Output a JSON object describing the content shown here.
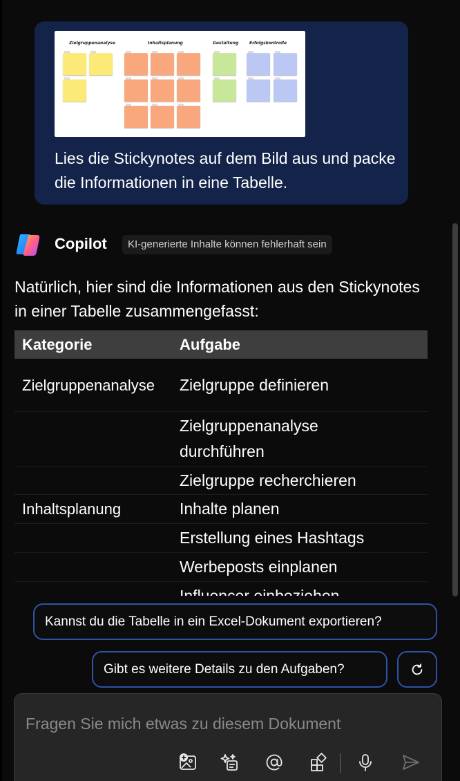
{
  "user_message": {
    "image": {
      "columns": [
        "Zielgruppenanalyse",
        "Inhaltsplanung",
        "Gestaltung",
        "Erfolgskontrolle"
      ]
    },
    "text": "Lies die Stickynotes auf dem Bild aus und packe die Informationen in eine Tabelle."
  },
  "assistant": {
    "name": "Copilot",
    "badge": "KI-generierte Inhalte können fehlerhaft sein",
    "intro": "Natürlich, hier sind die Informationen aus den Stickynotes in einer Tabelle zusammengefasst:",
    "table": {
      "headers": [
        "Kategorie",
        "Aufgabe"
      ],
      "rows": [
        {
          "category": "Zielgruppenanalyse",
          "task": "Zielgruppe definieren"
        },
        {
          "category": "",
          "task": "Zielgruppenanalyse durchführen"
        },
        {
          "category": "",
          "task": "Zielgruppe recherchieren"
        },
        {
          "category": "Inhaltsplanung",
          "task": "Inhalte planen"
        },
        {
          "category": "",
          "task": "Erstellung eines Hashtags"
        },
        {
          "category": "",
          "task": "Werbeposts einplanen"
        },
        {
          "category": "",
          "task": "Influencer einbeziehen"
        }
      ]
    }
  },
  "suggestions": [
    "Kannst du die Tabelle in ein Excel-Dokument exportieren?",
    "Gibt es weitere Details zu den Aufgaben?"
  ],
  "input": {
    "placeholder": "Fragen Sie mich etwas zu diesem Dokument"
  },
  "icons": {
    "refresh": "refresh-icon",
    "image_add": "image-add-icon",
    "prompts": "sparkle-prompts-icon",
    "mention": "at-mention-icon",
    "plugins": "apps-add-icon",
    "mic": "microphone-icon",
    "send": "send-icon"
  },
  "colors": {
    "background": "#0b0b0b",
    "user_bubble": "#13234a",
    "pill_border": "#3053a6",
    "table_header": "#3e3e3e",
    "input_bg": "#262626"
  }
}
